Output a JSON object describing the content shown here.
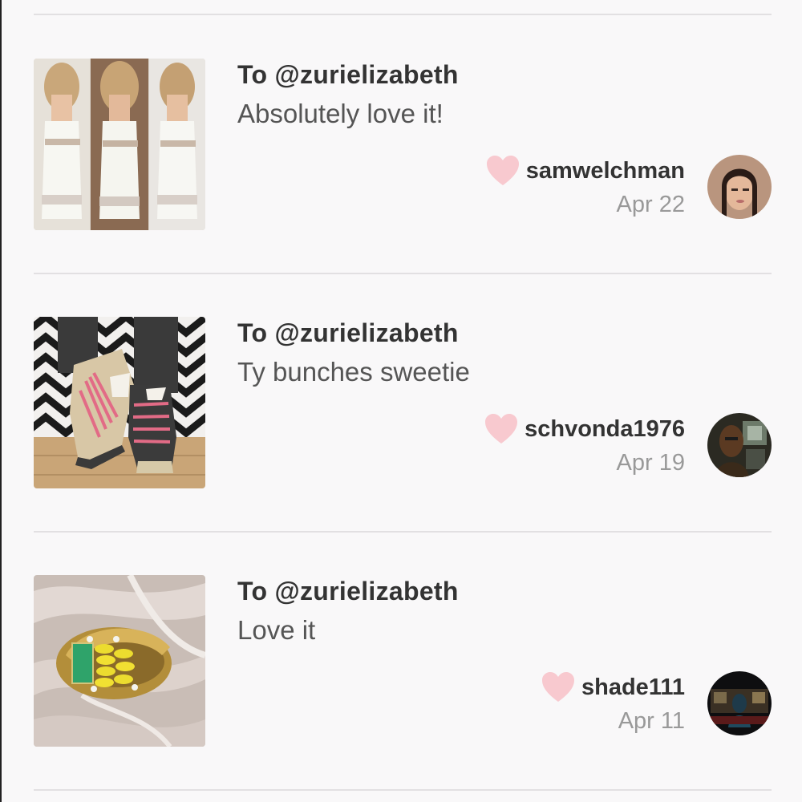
{
  "feed": {
    "items": [
      {
        "to": "To @zurielizabeth",
        "message": "Absolutely love it!",
        "username": "samwelchman",
        "date": "Apr 22",
        "thumb_icon": "white-dress-photo",
        "avatar_icon": "user-avatar"
      },
      {
        "to": "To @zurielizabeth",
        "message": "Ty bunches sweetie",
        "username": "schvonda1976",
        "date": "Apr 19",
        "thumb_icon": "sneakers-photo",
        "avatar_icon": "user-avatar"
      },
      {
        "to": "To @zurielizabeth",
        "message": "Love it",
        "username": "shade111",
        "date": "Apr 11",
        "thumb_icon": "bracelet-photo",
        "avatar_icon": "user-avatar"
      }
    ]
  },
  "colors": {
    "background": "#f9f8f9",
    "divider": "#e2e0e2",
    "heart": "#f8c9cf",
    "text_primary": "#333333",
    "text_secondary": "#555555",
    "text_muted": "#999999"
  }
}
